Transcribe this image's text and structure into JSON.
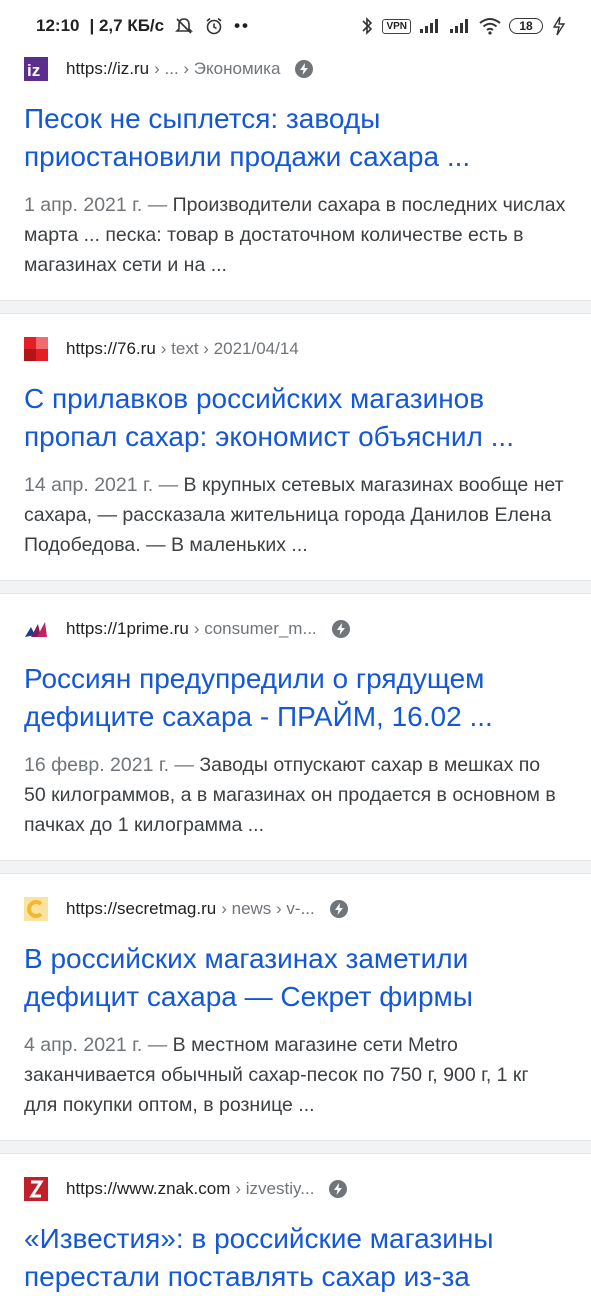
{
  "status_bar": {
    "time": "12:10",
    "net_speed": "| 2,7 КБ/с",
    "dots": "••",
    "vpn": "VPN",
    "battery": "18"
  },
  "results": [
    {
      "host": "https://iz.ru",
      "path": "› ... › Экономика",
      "favicon": "iz-favicon",
      "amp": true,
      "title": "Песок не сыплется: заводы приостановили продажи сахара ...",
      "date": "1 апр. 2021 г. —",
      "snippet": "Производители сахара в последних числах марта ... песка: товар в достаточном количестве есть в магазинах сети и на ..."
    },
    {
      "host": "https://76.ru",
      "path": "› text › 2021/04/14",
      "favicon": "76-favicon",
      "amp": false,
      "title": "С прилавков российских магазинов пропал сахар: экономист объяснил ...",
      "date": "14 апр. 2021 г. —",
      "snippet": "В крупных сетевых магазинах вообще нет сахара, — рассказала жительница города Данилов Елена Подобедова. — В маленьких ..."
    },
    {
      "host": "https://1prime.ru",
      "path": "› consumer_m...",
      "favicon": "prime-favicon",
      "amp": true,
      "title": "Россиян предупредили о грядущем дефиците сахара - ПРАЙМ, 16.02 ...",
      "date": "16 февр. 2021 г. —",
      "snippet": "Заводы отпускают сахар в мешках по 50 килограммов, а в магазинах он продается в основном в пачках до 1 килограмма ..."
    },
    {
      "host": "https://secretmag.ru",
      "path": "› news › v-...",
      "favicon": "secretmag-favicon",
      "amp": true,
      "title": "В российских магазинах заметили дефицит сахара — Секрет фирмы",
      "date": "4 апр. 2021 г. —",
      "snippet": "В местном магазине сети Metro заканчивается обычный сахар-песок по 750 г, 900 г, 1 кг для покупки оптом, в рознице ..."
    },
    {
      "host": "https://www.znak.com",
      "path": "› izvestiy...",
      "favicon": "znak-favicon",
      "amp": true,
      "title": "«Известия»: в российские магазины перестали поставлять сахар из-за",
      "date": "",
      "snippet": ""
    }
  ],
  "colors": {
    "link": "#1558d6",
    "divider": "#f1f3f4",
    "iz": "#5b2d8c",
    "r76": "#e31e24",
    "prime": "#7a1f5c",
    "secret": "#f3c64b",
    "znak": "#c0202b"
  }
}
